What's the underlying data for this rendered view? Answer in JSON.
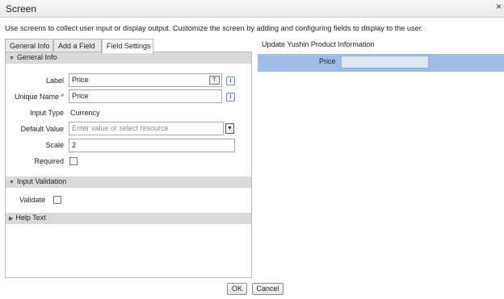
{
  "window": {
    "title": "Screen",
    "close_glyph": "×"
  },
  "description": "Use screens to collect user input or display output. Customize the screen by adding and configuring fields to display to the user.",
  "tabs": [
    {
      "label": "General Info"
    },
    {
      "label": "Add a Field"
    },
    {
      "label": "Field Settings",
      "active": true
    }
  ],
  "sections": {
    "general_info": {
      "label": "General Info",
      "expanded": true
    },
    "input_validation": {
      "label": "Input Validation",
      "expanded": true
    },
    "help_text": {
      "label": "Help Text",
      "expanded": false
    }
  },
  "fields": {
    "label": {
      "label": "Label",
      "value": "Price"
    },
    "unique_name": {
      "label": "Unique Name",
      "required_mark": "*",
      "value": "Price"
    },
    "input_type": {
      "label": "Input Type",
      "value": "Currency"
    },
    "default_value": {
      "label": "Default Value",
      "placeholder": "Enter value or select resource"
    },
    "scale": {
      "label": "Scale",
      "value": "2"
    },
    "required": {
      "label": "Required",
      "checked": false
    },
    "validate": {
      "label": "Validate",
      "checked": false
    }
  },
  "icons": {
    "info": "i",
    "resource_picker": "T",
    "expanded_triangle": "▼",
    "collapsed_triangle": "▶",
    "dropdown_arrow": "▼"
  },
  "preview": {
    "title": "Update Yushin Product Information",
    "field_label": "Price",
    "highlight_color": "#9ebde6"
  },
  "buttons": {
    "ok": "OK",
    "cancel": "Cancel"
  }
}
